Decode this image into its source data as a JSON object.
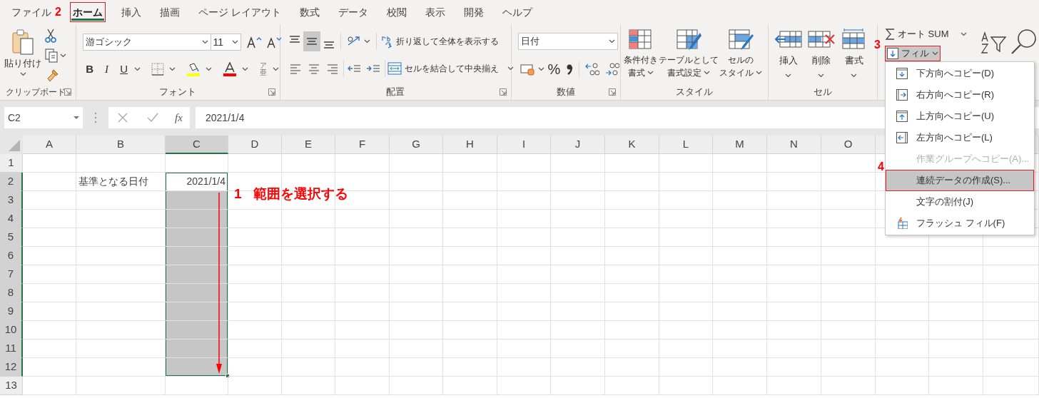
{
  "tabs": [
    {
      "label": "ファイル",
      "selected": false
    },
    {
      "label": "ホーム",
      "selected": true,
      "step": "2"
    },
    {
      "label": "挿入",
      "selected": false
    },
    {
      "label": "描画",
      "selected": false
    },
    {
      "label": "ページ レイアウト",
      "selected": false
    },
    {
      "label": "数式",
      "selected": false
    },
    {
      "label": "データ",
      "selected": false
    },
    {
      "label": "校閲",
      "selected": false
    },
    {
      "label": "表示",
      "selected": false
    },
    {
      "label": "開発",
      "selected": false
    },
    {
      "label": "ヘルプ",
      "selected": false
    }
  ],
  "ribbon": {
    "clipboard": {
      "label": "クリップボード",
      "paste": "貼り付け"
    },
    "font": {
      "label": "フォント",
      "font_name": "游ゴシック",
      "font_size": "11",
      "style_buttons": [
        "B",
        "I",
        "U"
      ],
      "phonetic": [
        "ア",
        "亜"
      ]
    },
    "alignment": {
      "label": "配置",
      "vertical_align": [
        {
          "selected": false
        },
        {
          "selected": true
        },
        {
          "selected": false
        }
      ],
      "wrap_text": "折り返して全体を表示する",
      "merge": "セルを結合して中央揃え"
    },
    "number": {
      "label": "数値",
      "format": "日付",
      "percent": "%"
    },
    "styles": {
      "label": "スタイル",
      "buttons": [
        {
          "lines": [
            "条件付き",
            "書式"
          ]
        },
        {
          "lines": [
            "テーブルとして",
            "書式設定"
          ]
        },
        {
          "lines": [
            "セルの",
            "スタイル"
          ]
        }
      ]
    },
    "cells": {
      "label": "セル",
      "buttons": [
        "挿入",
        "削除",
        "書式"
      ]
    },
    "editing": {
      "autosum": "オート SUM",
      "fill": {
        "label": "フィル",
        "expanded": true,
        "step": "3",
        "menu": [
          {
            "label": "下方向へコピー(D)",
            "disabled": false,
            "selected": false
          },
          {
            "label": "右方向へコピー(R)",
            "disabled": false,
            "selected": false
          },
          {
            "label": "上方向へコピー(U)",
            "disabled": false,
            "selected": false
          },
          {
            "label": "左方向へコピー(L)",
            "disabled": false,
            "selected": false
          },
          {
            "label": "作業グループへコピー(A)...",
            "disabled": true,
            "selected": false
          },
          {
            "label": "連続データの作成(S)...",
            "disabled": false,
            "selected": true,
            "step": "4"
          },
          {
            "label": "文字の割付(J)",
            "disabled": false,
            "selected": false
          },
          {
            "label": "フラッシュ フィル(F)",
            "disabled": false,
            "selected": false
          }
        ]
      }
    }
  },
  "formula_bar": {
    "name_box": "C2",
    "function_label": "fx",
    "formula": "2021/1/4"
  },
  "sheet": {
    "columns": [
      {
        "label": "A",
        "selected": false
      },
      {
        "label": "B",
        "selected": false
      },
      {
        "label": "C",
        "selected": true
      },
      {
        "label": "D",
        "selected": false
      },
      {
        "label": "E",
        "selected": false
      },
      {
        "label": "F",
        "selected": false
      },
      {
        "label": "G",
        "selected": false
      },
      {
        "label": "H",
        "selected": false
      },
      {
        "label": "I",
        "selected": false
      },
      {
        "label": "J",
        "selected": false
      },
      {
        "label": "K",
        "selected": false
      },
      {
        "label": "L",
        "selected": false
      },
      {
        "label": "M",
        "selected": false
      },
      {
        "label": "N",
        "selected": false
      },
      {
        "label": "O",
        "selected": false
      }
    ],
    "rows": [
      {
        "label": "1",
        "selected": false
      },
      {
        "label": "2",
        "selected": true
      },
      {
        "label": "3",
        "selected": true
      },
      {
        "label": "4",
        "selected": true
      },
      {
        "label": "5",
        "selected": true
      },
      {
        "label": "6",
        "selected": true
      },
      {
        "label": "7",
        "selected": true
      },
      {
        "label": "8",
        "selected": true
      },
      {
        "label": "9",
        "selected": true
      },
      {
        "label": "10",
        "selected": true
      },
      {
        "label": "11",
        "selected": true
      },
      {
        "label": "12",
        "selected": true
      },
      {
        "label": "13",
        "selected": false
      }
    ],
    "cells": [
      {
        "kind": "label",
        "text": "基準となる日付"
      },
      {
        "kind": "date",
        "text": "2021/1/4"
      }
    ],
    "annotation": {
      "step": "1",
      "text": "範囲を選択する"
    }
  }
}
